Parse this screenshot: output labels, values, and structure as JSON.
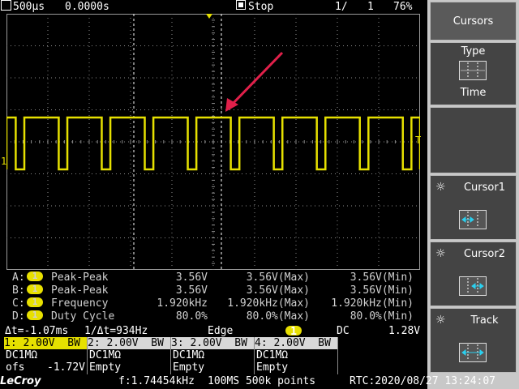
{
  "topbar": {
    "timebase": "500µs",
    "delay": "0.0000s",
    "run_state": "Stop",
    "acq_count": "1/",
    "acq_total": "1",
    "battery": "76%"
  },
  "colors": {
    "trace": "#e6e000",
    "grid_line": "#8c8c8c",
    "arrow": "#e0204a"
  },
  "icons": [
    "trigger-icon",
    "stop-icon",
    "history-icon",
    "battery-icon",
    "gear-icon",
    "arrow-annotation-icon"
  ],
  "menu": {
    "title": "Cursors",
    "type_label": "Type",
    "type_value": "Time",
    "cursor1_label": "Cursor1",
    "cursor2_label": "Cursor2",
    "track_label": "Track"
  },
  "trace": {
    "ground_marker": "1",
    "trigger_marker": "T",
    "waveform": {
      "duty_cycle": 0.8,
      "period_divisions": 1.04
    }
  },
  "measurements": [
    {
      "slot": "A:",
      "ch": "1",
      "name": "Peak-Peak",
      "value": "3.56V",
      "max": "3.56V(Max)",
      "min": "3.56V(Min)"
    },
    {
      "slot": "B:",
      "ch": "1",
      "name": "Peak-Peak",
      "value": "3.56V",
      "max": "3.56V(Max)",
      "min": "3.56V(Min)"
    },
    {
      "slot": "C:",
      "ch": "1",
      "name": "Frequency",
      "value": "1.920kHz",
      "max": "1.920kHz(Max)",
      "min": "1.920kHz(Min)"
    },
    {
      "slot": "D:",
      "ch": "1",
      "name": "Duty Cycle",
      "value": "80.0%",
      "max": "80.0%(Max)",
      "min": "80.0%(Min)"
    }
  ],
  "cursor_readout": {
    "delta_t": "Δt=-1.07ms",
    "inv_delta_t": "1/Δt=934Hz",
    "trigger_type": "Edge",
    "trigger_ch": "1",
    "coupling": "DC",
    "trigger_level": "1.28V"
  },
  "channels": [
    {
      "hdr": "1: 2.00V  BW",
      "coupling": "DC1MΩ",
      "l3a": "ofs",
      "l3b": "-1.72V"
    },
    {
      "hdr": "2: 2.00V  BW",
      "coupling": "DC1MΩ",
      "l3a": "Empty",
      "l3b": ""
    },
    {
      "hdr": "3: 2.00V  BW",
      "coupling": "DC1MΩ",
      "l3a": "Empty",
      "l3b": ""
    },
    {
      "hdr": "4: 2.00V  BW",
      "coupling": "DC1MΩ",
      "l3a": "Empty",
      "l3b": ""
    }
  ],
  "bottom": {
    "brand": "LeCroy",
    "frequency": "f:1.74454kHz",
    "sample": "100MS 500k points",
    "rtc": "RTC:2020/08/27 13:24:07"
  }
}
